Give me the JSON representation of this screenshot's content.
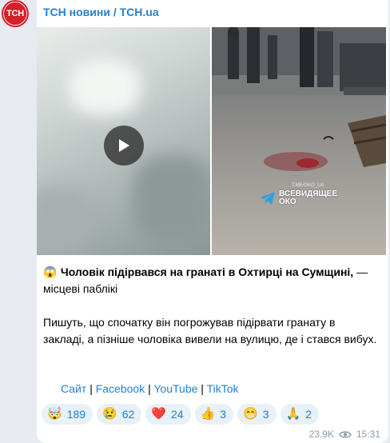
{
  "channel": {
    "avatar_text": "ТСН",
    "name": "ТСН новини / TCH.ua"
  },
  "media": {
    "watermark_small": "T.ME/OKO_UA",
    "watermark_line1": "ВСЕВИДЯЩЕЕ",
    "watermark_line2": "ОКО"
  },
  "post": {
    "emoji": "😱",
    "headline": "Чоловік підірвався на гранаті в Охтирці на Сумщині,",
    "headline_tail": " — місцеві паблікі",
    "body": "Пишуть, що спочатку він погрожував підірвати гранату в закладі, а пізніше чоловіка вивели на вулицю, де і стався вибух."
  },
  "links": {
    "site": "Сайт",
    "facebook": "Facebook",
    "youtube": "YouTube",
    "tiktok": "TikTok",
    "separator": "|"
  },
  "reactions": [
    {
      "emoji": "🤯",
      "count": "189"
    },
    {
      "emoji": "😢",
      "count": "62"
    },
    {
      "emoji": "❤️",
      "count": "24"
    },
    {
      "emoji": "👍",
      "count": "3"
    },
    {
      "emoji": "😁",
      "count": "3"
    },
    {
      "emoji": "🙏",
      "count": "2"
    }
  ],
  "meta": {
    "views": "23.9K",
    "time": "15:31"
  },
  "colors": {
    "accent": "#2481cc",
    "brand": "#d32029"
  }
}
